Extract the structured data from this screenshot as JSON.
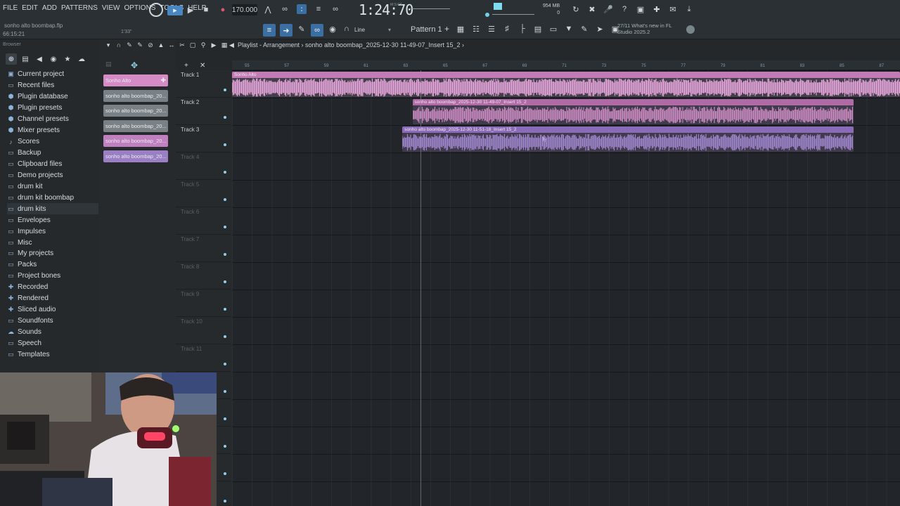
{
  "menu": [
    "FILE",
    "EDIT",
    "ADD",
    "PATTERNS",
    "VIEW",
    "OPTIONS",
    "TOOLS",
    "HELP"
  ],
  "file": {
    "name": "sonho alto boombap.flp",
    "elapsed": "66:15:21",
    "song_pos_mini": "1'33\""
  },
  "transport": {
    "tempo": "170.000",
    "time": "1:24:70",
    "time_suffix": "M:S:CS"
  },
  "memory": {
    "line1": "954 MB",
    "line2": "0"
  },
  "pattern": {
    "label": "Pattern 1",
    "snap": "Line",
    "news_line1": "27/11  What's new in FL",
    "news_line2": "Studio 2025.2"
  },
  "browser": {
    "header": "Browser",
    "items": [
      {
        "label": "Current project",
        "icon": "project-icon"
      },
      {
        "label": "Recent files",
        "icon": "folder-icon"
      },
      {
        "label": "Plugin database",
        "icon": "plugin-icon"
      },
      {
        "label": "Plugin presets",
        "icon": "plugin-icon"
      },
      {
        "label": "Channel presets",
        "icon": "plugin-icon"
      },
      {
        "label": "Mixer presets",
        "icon": "plugin-icon"
      },
      {
        "label": "Scores",
        "icon": "note-icon"
      },
      {
        "label": "Backup",
        "icon": "folder-icon"
      },
      {
        "label": "Clipboard files",
        "icon": "folder-icon"
      },
      {
        "label": "Demo projects",
        "icon": "folder-icon"
      },
      {
        "label": "drum kit",
        "icon": "folder-icon"
      },
      {
        "label": "drum kit boombap",
        "icon": "folder-icon"
      },
      {
        "label": "drum kits",
        "icon": "folder-icon"
      },
      {
        "label": "Envelopes",
        "icon": "folder-icon"
      },
      {
        "label": "Impulses",
        "icon": "folder-icon"
      },
      {
        "label": "Misc",
        "icon": "folder-icon"
      },
      {
        "label": "My projects",
        "icon": "folder-icon"
      },
      {
        "label": "Packs",
        "icon": "folder-icon"
      },
      {
        "label": "Project bones",
        "icon": "folder-icon"
      },
      {
        "label": "Recorded",
        "icon": "plus-icon"
      },
      {
        "label": "Rendered",
        "icon": "plus-icon"
      },
      {
        "label": "Sliced audio",
        "icon": "plus-icon"
      },
      {
        "label": "Soundfonts",
        "icon": "folder-icon"
      },
      {
        "label": "Sounds",
        "icon": "cloud-icon"
      },
      {
        "label": "Speech",
        "icon": "folder-icon"
      },
      {
        "label": "Templates",
        "icon": "folder-icon"
      }
    ]
  },
  "channels": [
    {
      "label": "Sonho Alto",
      "color": "#d58bc6"
    },
    {
      "label": "sonho alto boombap_20...",
      "color": "#7a8186"
    },
    {
      "label": "sonho alto boombap_20...",
      "color": "#7a8186"
    },
    {
      "label": "sonho alto boombap_20...",
      "color": "#7a8186"
    },
    {
      "label": "sonho alto boombap_20...",
      "color": "#c080c0"
    },
    {
      "label": "sonho alto boombap_20...",
      "color": "#9b7fc4"
    }
  ],
  "playlist": {
    "title": "Playlist - Arrangement › sonho alto boombap_2025-12-30 11-49-07_Insert 15_2 ›",
    "ticks": [
      "55",
      "57",
      "59",
      "61",
      "63",
      "65",
      "67",
      "69",
      "71",
      "73",
      "75",
      "77",
      "79",
      "81",
      "83",
      "85",
      "87"
    ],
    "tracks": [
      "Track 1",
      "Track 2",
      "Track 3",
      "Track 4",
      "Track 5",
      "Track 6",
      "Track 7",
      "Track 8",
      "Track 9",
      "Track 10",
      "Track 11"
    ],
    "clips": [
      {
        "title": "Sonho Alto",
        "track": 0,
        "color": "#e6a7dd",
        "header": "#c37bb6",
        "start": 0.0,
        "end": 1.0
      },
      {
        "title": "sonho alto boombap_2025-12-30 11-49-07_Insert 15_2",
        "track": 1,
        "color": "#c98ac0",
        "header": "#b06aa5",
        "start": 0.27,
        "end": 0.93
      },
      {
        "title": "sonho alto boombap_2025-12-30 11-51-18_Insert 15_2",
        "track": 2,
        "color": "#9f86cc",
        "header": "#8a6bb8",
        "start": 0.255,
        "end": 0.93
      }
    ]
  }
}
